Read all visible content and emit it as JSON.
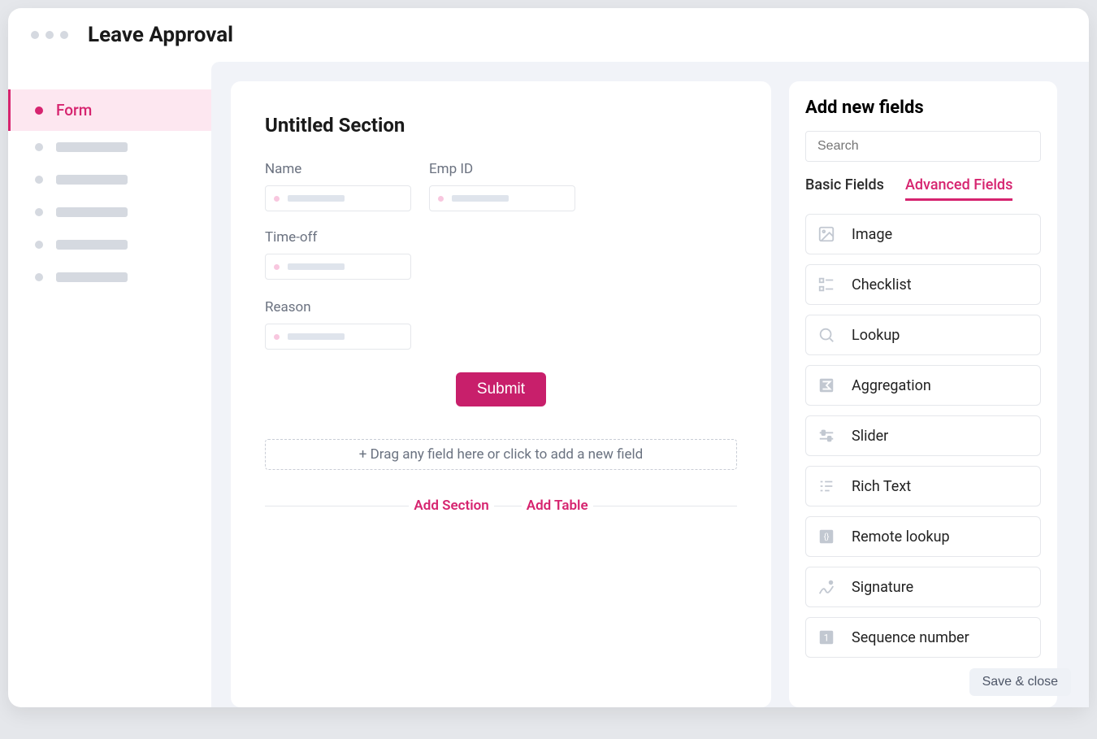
{
  "app_title": "Leave Approval",
  "sidebar": {
    "active_label": "Form"
  },
  "form": {
    "section_title": "Untitled Section",
    "fields": {
      "name": "Name",
      "emp_id": "Emp ID",
      "time_off": "Time-off",
      "reason": "Reason"
    },
    "submit_label": "Submit",
    "dropzone_text": "+ Drag any field here or click to add a new field",
    "add_section": "Add Section",
    "add_table": "Add Table"
  },
  "panel": {
    "title": "Add new fields",
    "search_placeholder": "Search",
    "tab_basic": "Basic Fields",
    "tab_advanced": "Advanced Fields",
    "options": {
      "image": "Image",
      "checklist": "Checklist",
      "lookup": "Lookup",
      "aggregation": "Aggregation",
      "slider": "Slider",
      "rich_text": "Rich Text",
      "remote_lookup": "Remote lookup",
      "signature": "Signature",
      "sequence_number": "Sequence number"
    }
  },
  "footer": {
    "save_close": "Save & close"
  }
}
